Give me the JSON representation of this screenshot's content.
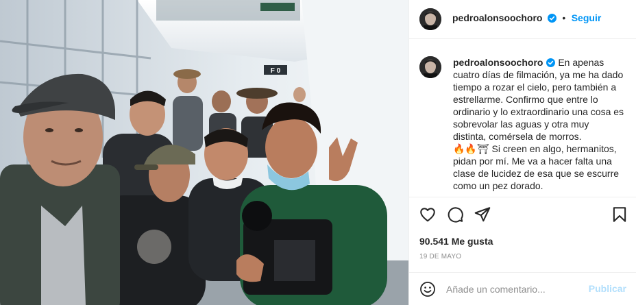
{
  "post": {
    "username": "pedroalonsoochoro",
    "follow_label": "Seguir",
    "separator": "•",
    "caption_text": "En apenas cuatro días de filmación, ya me ha dado tiempo a rozar el cielo, pero también a estrellarme. Confirmo que entre lo ordinario y lo extraordinario una cosa es sobrevolar las aguas y otra muy distinta, comérsela de morros.",
    "caption_emojis": "🔥🔥⛩",
    "caption_text_2": "Si creen en algo, hermanitos, pidan por mí. Me va a hacer falta una clase de lucidez de esa que se escurre como un pez dorado.",
    "likes": "90.541 Me gusta",
    "date": "19 DE MAYO"
  },
  "comment": {
    "placeholder": "Añade un comentario...",
    "publish_label": "Publicar"
  },
  "photo": {
    "sign_text": "F 0"
  },
  "icons": {
    "like": "heart-icon",
    "comment": "comment-icon",
    "share": "share-icon",
    "save": "bookmark-icon",
    "emoji": "emoji-icon",
    "verified": "verified-badge-icon"
  },
  "colors": {
    "accent": "#0095f6",
    "publish_disabled": "#b2dffc",
    "muted": "#8e8e8e",
    "text": "#262626"
  }
}
